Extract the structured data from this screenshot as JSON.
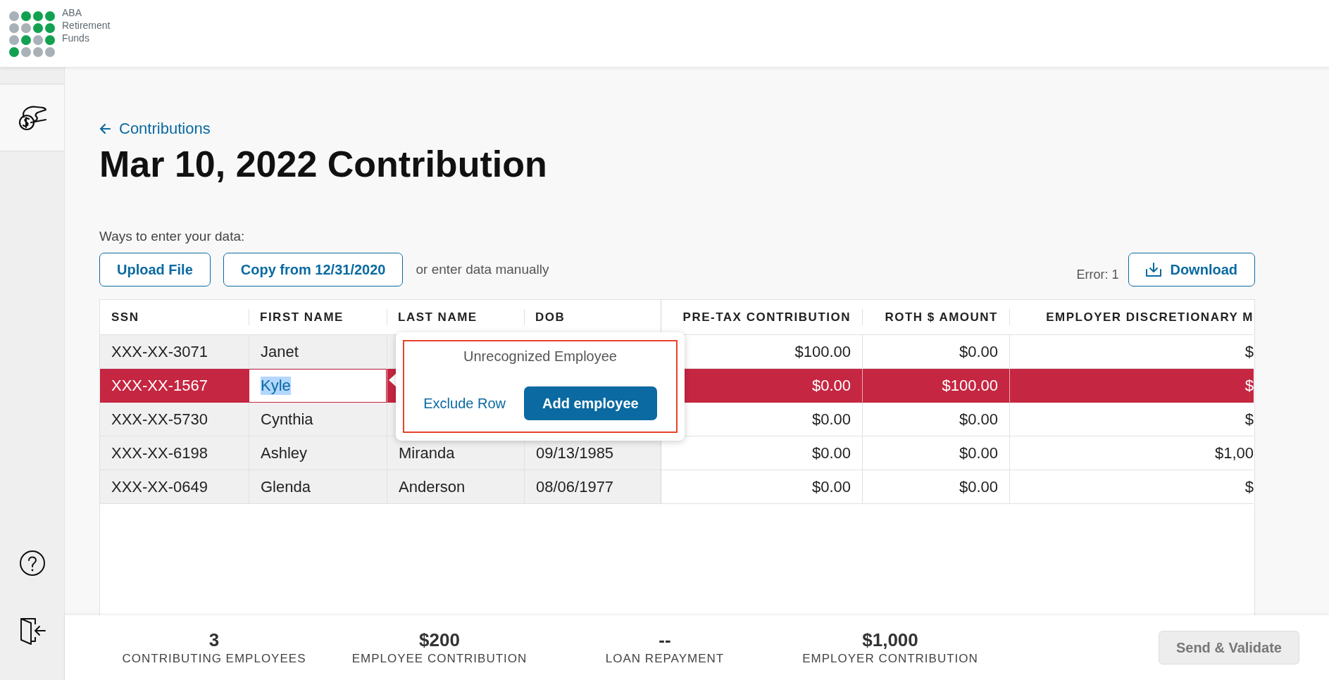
{
  "logo": {
    "lines": [
      "ABA",
      "Retirement",
      "Funds"
    ]
  },
  "sidebar": {
    "items": [
      {
        "kind": "contributions",
        "selected": true
      }
    ],
    "bottom": [
      {
        "kind": "help"
      },
      {
        "kind": "logout"
      }
    ]
  },
  "back_link": "Contributions",
  "title": "Mar 10, 2022 Contribution",
  "entry": {
    "label": "Ways to enter your data:",
    "buttons": [
      "Upload File",
      "Copy from 12/31/2020"
    ],
    "note": "or enter data manually"
  },
  "error_count": "Error: 1",
  "download": "Download",
  "table": {
    "columns": [
      "SSN",
      "FIRST NAME",
      "LAST NAME",
      "DOB",
      "PRE-TAX CONTRIBUTION",
      "ROTH $ AMOUNT",
      "EMPLOYER DISCRETIONARY M"
    ],
    "rows": [
      {
        "cells": [
          "XXX-XX-3071",
          "Janet",
          null,
          null,
          "$100.00",
          "$0.00",
          "$"
        ],
        "error": false,
        "editing": false
      },
      {
        "cells": [
          "XXX-XX-1567",
          "Kyle",
          null,
          null,
          "$0.00",
          "$100.00",
          "$"
        ],
        "error": true,
        "editing": true
      },
      {
        "cells": [
          "XXX-XX-5730",
          "Cynthia",
          null,
          null,
          "$0.00",
          "$0.00",
          "$"
        ],
        "error": false,
        "editing": false
      },
      {
        "cells": [
          "XXX-XX-6198",
          "Ashley",
          "Miranda",
          "09/13/1985",
          "$0.00",
          "$0.00",
          "$1,00"
        ],
        "error": false,
        "editing": false
      },
      {
        "cells": [
          "XXX-XX-0649",
          "Glenda",
          "Anderson",
          "08/06/1977",
          "$0.00",
          "$0.00",
          "$"
        ],
        "error": false,
        "editing": false
      }
    ]
  },
  "popup": {
    "title": "Unrecognized Employee",
    "link": "Exclude Row",
    "button": "Add employee"
  },
  "summary": {
    "stats": [
      {
        "value": "3",
        "label": "CONTRIBUTING EMPLOYEES"
      },
      {
        "value": "$200",
        "label": "EMPLOYEE CONTRIBUTION"
      },
      {
        "value": "--",
        "label": "LOAN REPAYMENT"
      },
      {
        "value": "$1,000",
        "label": "EMPLOYER CONTRIBUTION"
      }
    ],
    "action": {
      "label": "Send & Validate",
      "disabled": true
    }
  }
}
